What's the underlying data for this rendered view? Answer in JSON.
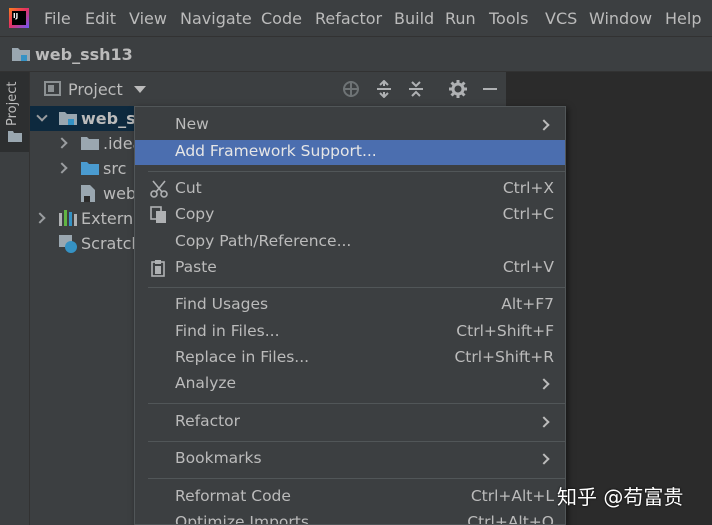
{
  "menubar": {
    "items": [
      "File",
      "Edit",
      "View",
      "Navigate",
      "Code",
      "Refactor",
      "Build",
      "Run",
      "Tools",
      "VCS",
      "Window",
      "Help"
    ],
    "logo_icon": "intellij-idea-logo"
  },
  "navbar": {
    "project_name": "web_ssh13"
  },
  "tool_strip": {
    "project_tab": "Project"
  },
  "project_panel": {
    "title": "Project",
    "tools": [
      "locate-icon",
      "expand-all-icon",
      "collapse-all-icon",
      "gear-icon",
      "hide-icon"
    ],
    "tree": [
      {
        "label": "web_ss",
        "expanded": true,
        "icon": "module-folder-icon",
        "selected": true
      },
      {
        "label": ".idea",
        "expanded": false,
        "icon": "folder-icon"
      },
      {
        "label": "src",
        "expanded": false,
        "icon": "source-folder-icon"
      },
      {
        "label": "web",
        "icon": "file-icon"
      },
      {
        "label": "Externa",
        "expanded": false,
        "icon": "libraries-icon"
      },
      {
        "label": "Scratch",
        "icon": "scratches-icon"
      }
    ]
  },
  "context_menu": {
    "items": [
      {
        "label": "New",
        "submenu": true
      },
      {
        "label": "Add Framework Support...",
        "highlighted": true
      },
      {
        "label": "Cut",
        "shortcut": "Ctrl+X",
        "icon": "scissors-icon"
      },
      {
        "label": "Copy",
        "shortcut": "Ctrl+C",
        "icon": "copy-icon"
      },
      {
        "label": "Copy Path/Reference..."
      },
      {
        "label": "Paste",
        "shortcut": "Ctrl+V",
        "icon": "paste-icon"
      },
      {
        "label": "Find Usages",
        "shortcut": "Alt+F7"
      },
      {
        "label": "Find in Files...",
        "shortcut": "Ctrl+Shift+F"
      },
      {
        "label": "Replace in Files...",
        "shortcut": "Ctrl+Shift+R"
      },
      {
        "label": "Analyze",
        "submenu": true
      },
      {
        "label": "Refactor",
        "submenu": true
      },
      {
        "label": "Bookmarks",
        "submenu": true
      },
      {
        "label": "Reformat Code",
        "shortcut": "Ctrl+Alt+L"
      },
      {
        "label": "Optimize Imports",
        "shortcut": "Ctrl+Alt+O"
      }
    ]
  },
  "watermark": "知乎 @苟富贵",
  "colors": {
    "highlight": "#4b6eaf",
    "selected_row": "#0d293e",
    "menu_bg": "#3c3f41",
    "editor_bg": "#2b2b2b"
  }
}
